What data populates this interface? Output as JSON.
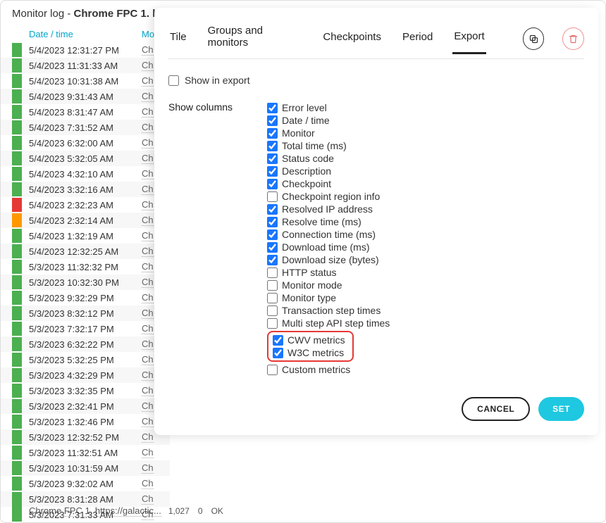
{
  "title_prefix": "Monitor log -  ",
  "title_name": "Chrome FPC 1. h",
  "log_header": {
    "date": "Date / time",
    "mo": "Mo"
  },
  "monitor_short": "Ch",
  "rows": [
    {
      "dt": "5/4/2023 12:31:27 PM",
      "status": "green"
    },
    {
      "dt": "5/4/2023 11:31:33 AM",
      "status": "green"
    },
    {
      "dt": "5/4/2023 10:31:38 AM",
      "status": "green"
    },
    {
      "dt": "5/4/2023 9:31:43 AM",
      "status": "green"
    },
    {
      "dt": "5/4/2023 8:31:47 AM",
      "status": "green"
    },
    {
      "dt": "5/4/2023 7:31:52 AM",
      "status": "green"
    },
    {
      "dt": "5/4/2023 6:32:00 AM",
      "status": "green"
    },
    {
      "dt": "5/4/2023 5:32:05 AM",
      "status": "green"
    },
    {
      "dt": "5/4/2023 4:32:10 AM",
      "status": "green"
    },
    {
      "dt": "5/4/2023 3:32:16 AM",
      "status": "green"
    },
    {
      "dt": "5/4/2023 2:32:23 AM",
      "status": "red"
    },
    {
      "dt": "5/4/2023 2:32:14 AM",
      "status": "orange"
    },
    {
      "dt": "5/4/2023 1:32:19 AM",
      "status": "green"
    },
    {
      "dt": "5/4/2023 12:32:25 AM",
      "status": "green"
    },
    {
      "dt": "5/3/2023 11:32:32 PM",
      "status": "green"
    },
    {
      "dt": "5/3/2023 10:32:30 PM",
      "status": "green"
    },
    {
      "dt": "5/3/2023 9:32:29 PM",
      "status": "green"
    },
    {
      "dt": "5/3/2023 8:32:12 PM",
      "status": "green"
    },
    {
      "dt": "5/3/2023 7:32:17 PM",
      "status": "green"
    },
    {
      "dt": "5/3/2023 6:32:22 PM",
      "status": "green"
    },
    {
      "dt": "5/3/2023 5:32:25 PM",
      "status": "green"
    },
    {
      "dt": "5/3/2023 4:32:29 PM",
      "status": "green"
    },
    {
      "dt": "5/3/2023 3:32:35 PM",
      "status": "green"
    },
    {
      "dt": "5/3/2023 2:32:41 PM",
      "status": "green"
    },
    {
      "dt": "5/3/2023 1:32:46 PM",
      "status": "green"
    },
    {
      "dt": "5/3/2023 12:32:52 PM",
      "status": "green"
    },
    {
      "dt": "5/3/2023 11:32:51 AM",
      "status": "green"
    },
    {
      "dt": "5/3/2023 10:31:59 AM",
      "status": "green"
    },
    {
      "dt": "5/3/2023 9:32:02 AM",
      "status": "green"
    },
    {
      "dt": "5/3/2023 8:31:28 AM",
      "status": "green"
    },
    {
      "dt": "5/3/2023 7:31:33 AM",
      "status": "green"
    }
  ],
  "below": {
    "monitor": "Chrome FPC 1. https://galactic...",
    "v1": "1,027",
    "v2": "0",
    "v3": "OK"
  },
  "tabs": [
    "Tile",
    "Groups and monitors",
    "Checkpoints",
    "Period",
    "Export"
  ],
  "active_tab": 4,
  "show_in_export": {
    "label": "Show in export",
    "checked": false
  },
  "show_columns_label": "Show columns",
  "columns": [
    {
      "label": "Error level",
      "checked": true
    },
    {
      "label": "Date / time",
      "checked": true
    },
    {
      "label": "Monitor",
      "checked": true
    },
    {
      "label": "Total time (ms)",
      "checked": true
    },
    {
      "label": "Status code",
      "checked": true
    },
    {
      "label": "Description",
      "checked": true
    },
    {
      "label": "Checkpoint",
      "checked": true
    },
    {
      "label": "Checkpoint region info",
      "checked": false
    },
    {
      "label": "Resolved IP address",
      "checked": true
    },
    {
      "label": "Resolve time (ms)",
      "checked": true
    },
    {
      "label": "Connection time (ms)",
      "checked": true
    },
    {
      "label": "Download time (ms)",
      "checked": true
    },
    {
      "label": "Download size (bytes)",
      "checked": true
    },
    {
      "label": "HTTP status",
      "checked": false
    },
    {
      "label": "Monitor mode",
      "checked": false
    },
    {
      "label": "Monitor type",
      "checked": false
    },
    {
      "label": "Transaction step times",
      "checked": false
    },
    {
      "label": "Multi step API step times",
      "checked": false
    },
    {
      "label": "CWV metrics",
      "checked": true,
      "hl": true
    },
    {
      "label": "W3C metrics",
      "checked": true,
      "hl": true
    },
    {
      "label": "Custom metrics",
      "checked": false
    }
  ],
  "buttons": {
    "cancel": "CANCEL",
    "set": "SET"
  }
}
